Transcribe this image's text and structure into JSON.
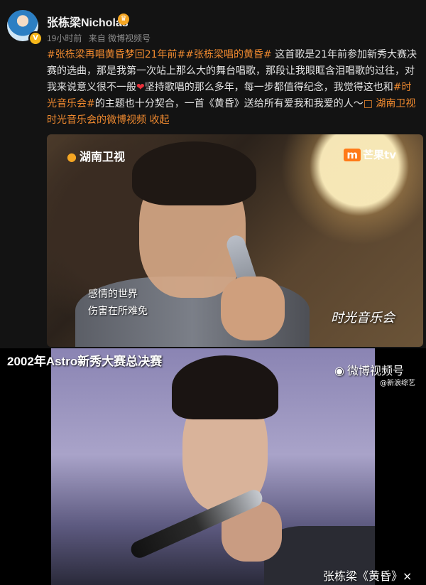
{
  "post": {
    "username": "张栋梁Nicholas",
    "verified_badge": "V",
    "crown": "♛",
    "time": "19小时前",
    "source": "来自 微博视频号",
    "text": [
      {
        "t": "#张栋梁再唱黄昏梦回21年前##张栋梁唱的黄昏#",
        "hl": true
      },
      {
        "t": " 这首歌是21年前参加新秀大赛决赛的选曲，那是我第一次站上那么大的舞台唱歌，那段让我眼眶含泪唱歌的过往，对我来说意义很不一般",
        "hl": false
      },
      {
        "t": "❤",
        "heart": true
      },
      {
        "t": "坚持歌唱的那么多年，每一步都值得纪念，我觉得这也和",
        "hl": false
      },
      {
        "t": "#时光音乐会#",
        "hl": true
      },
      {
        "t": "的主题也十分契合，一首《黄昏》送给所有爱我和我爱的人～",
        "hl": false
      },
      {
        "t": "□ 湖南卫视时光音乐会的微博视频",
        "hl": true
      },
      {
        "t": " ",
        "hl": false
      },
      {
        "t": "收起",
        "hl": true
      }
    ]
  },
  "video1": {
    "logo_left": "湖南卫视",
    "logo_right_mark": "m",
    "logo_right": "芒果tv",
    "subtitle_1": "感情的世界",
    "subtitle_2": "伤害在所难免",
    "show_logo": "时光音乐会"
  },
  "video2": {
    "caption_top": "2002年Astro新秀大赛总决赛",
    "platform": "微博视频号",
    "platform_sub": "@新浪综艺",
    "caption_bottom": "张栋梁《黄昏》×"
  },
  "colors": {
    "accent": "#f08a2f",
    "background": "#131313"
  }
}
